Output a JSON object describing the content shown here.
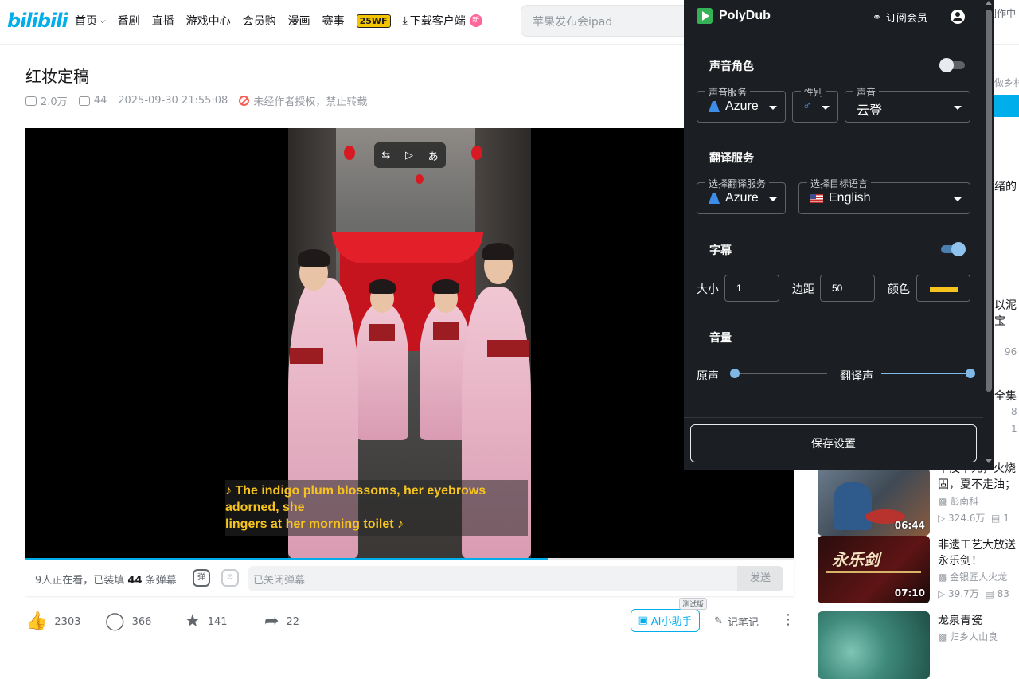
{
  "topbar": {
    "logo": "bilibili",
    "nav": [
      {
        "label": "首页",
        "dropdown": true
      },
      {
        "label": "番剧"
      },
      {
        "label": "直播"
      },
      {
        "label": "游戏中心"
      },
      {
        "label": "会员购"
      },
      {
        "label": "漫画"
      },
      {
        "label": "赛事"
      }
    ],
    "badge_25wf": "25WF",
    "download_label": "下载客户端",
    "download_badge": "新",
    "search_placeholder": "苹果发布会ipad",
    "right_peek": "创作中"
  },
  "video": {
    "title": "红妆定稿",
    "views": "2.0万",
    "danmaku_count": "44",
    "datetime": "2025-09-30 21:55:08",
    "copyright_notice": "未经作者授权，禁止转载",
    "subtitle_line1": "♪ The indigo plum blossoms, her eyebrows adorned, she",
    "subtitle_line2": "lingers at her morning toilet ♪",
    "top_controls": [
      "⇆",
      "▷",
      "あ"
    ],
    "progress": 0.68
  },
  "danmaku_bar": {
    "watching_prefix": "9人正在看，已装填",
    "watching_count": "44",
    "watching_suffix": "条弹幕",
    "icon1": "弹",
    "icon2": "⚙",
    "input_placeholder": "已关闭弹幕",
    "send": "发送"
  },
  "actions": {
    "like": "2303",
    "coin": "366",
    "favorite": "141",
    "share": "22",
    "ai_assistant": "AI小助手",
    "trial": "测试版",
    "notes": "记笔记",
    "more": "⋮"
  },
  "right_column": {
    "peek_1": "做乡村",
    "peek_2": "绪的",
    "peek_3": "以泥",
    "peek_4": "宝",
    "peek_5": "96",
    "peek_6": "全集",
    "peek_7": "8",
    "peek_8": "1",
    "items": [
      {
        "title_1": "不没不死，火烧",
        "title_2": "固，夏不走油；",
        "up": "彭南科",
        "views": "324.6万",
        "count": "1",
        "duration": "06:44"
      },
      {
        "title_1": "非遗工艺大放送",
        "title_2": "永乐剑！",
        "up": "金银匠人火龙",
        "views": "39.7万",
        "count": "83",
        "duration": "07:10",
        "thumb_text": "永乐剑"
      },
      {
        "title_1": "龙泉青瓷",
        "title_2": "",
        "up": "归乡人山良",
        "views": "",
        "count": "",
        "duration": ""
      }
    ]
  },
  "polydub": {
    "name": "PolyDub",
    "subscribe": "订阅会员",
    "voice_section": "声音角色",
    "voice_toggle_on": false,
    "voice_service_label": "声音服务",
    "voice_service_value": "Azure",
    "gender_label": "性别",
    "gender_value": "♂",
    "voice_label": "声音",
    "voice_value": "云登",
    "translate_section": "翻译服务",
    "translate_service_label": "选择翻译服务",
    "translate_service_value": "Azure",
    "target_lang_label": "选择目标语言",
    "target_lang_value": "English",
    "subtitle_section": "字幕",
    "subtitle_toggle_on": true,
    "size_label": "大小",
    "size_value": "1",
    "margin_label": "边距",
    "margin_value": "50",
    "color_label": "颜色",
    "subtitle_color": "#f7c41f",
    "volume_section": "音量",
    "original_label": "原声",
    "original_volume": 0.0,
    "dub_label": "翻译声",
    "dub_volume": 1.0,
    "save": "保存设置"
  }
}
